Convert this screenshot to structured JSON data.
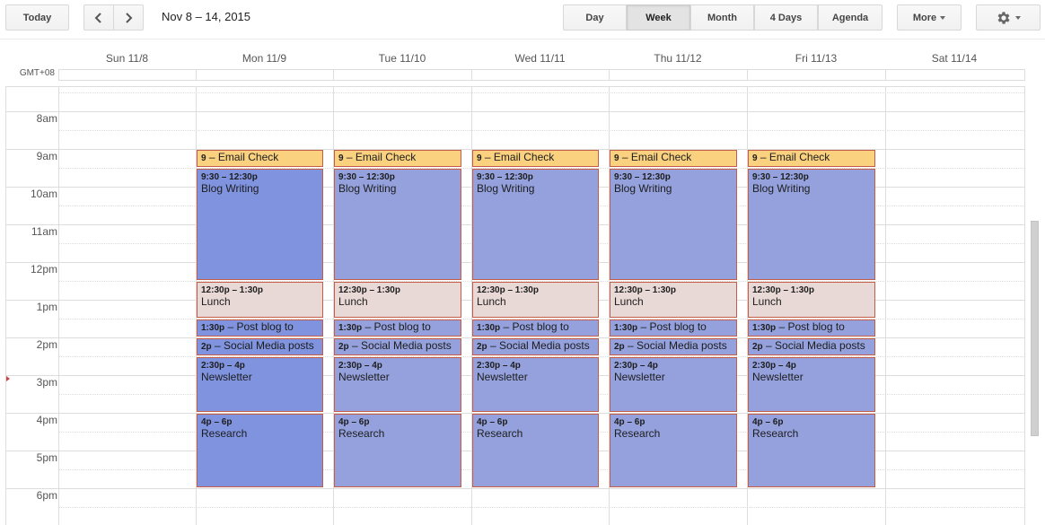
{
  "toolbar": {
    "today_label": "Today",
    "prev_icon": "chevron-left-icon",
    "next_icon": "chevron-right-icon",
    "date_range": "Nov 8 – 14, 2015",
    "views": [
      {
        "label": "Day",
        "active": false
      },
      {
        "label": "Week",
        "active": true
      },
      {
        "label": "Month",
        "active": false
      },
      {
        "label": "4 Days",
        "active": false
      },
      {
        "label": "Agenda",
        "active": false
      }
    ],
    "more_label": "More",
    "settings_icon": "gear-icon"
  },
  "timezone": "GMT+08",
  "days": [
    "Sun 11/8",
    "Mon 11/9",
    "Tue 11/10",
    "Wed 11/11",
    "Thu 11/12",
    "Fri 11/13",
    "Sat 11/14"
  ],
  "hours": [
    "8am",
    "9am",
    "10am",
    "11am",
    "12pm",
    "1pm",
    "2pm",
    "3pm",
    "4pm",
    "5pm",
    "6pm"
  ],
  "colors": {
    "email": "#f9d17f",
    "blue_selected": "#7f93df",
    "blue": "#94a1dd",
    "lunch": "#e9d9d6",
    "border": "#c45c48"
  },
  "events_per_day": [
    {
      "time": "9",
      "title": "Email Check",
      "start": 9.0,
      "end": 9.5,
      "kind": "email",
      "one_line": true
    },
    {
      "time": "9:30 – 12:30p",
      "title": "Blog Writing",
      "start": 9.5,
      "end": 12.5,
      "kind": "blue",
      "one_line": false
    },
    {
      "time": "12:30p – 1:30p",
      "title": "Lunch",
      "start": 12.5,
      "end": 13.5,
      "kind": "lunch",
      "one_line": false
    },
    {
      "time": "1:30p",
      "title": "Post blog to Word",
      "start": 13.5,
      "end": 14.0,
      "kind": "blue",
      "one_line": true
    },
    {
      "time": "2p",
      "title": "Social Media posts",
      "start": 14.0,
      "end": 14.5,
      "kind": "blue",
      "one_line": true
    },
    {
      "time": "2:30p – 4p",
      "title": "Newsletter",
      "start": 14.5,
      "end": 16.0,
      "kind": "blue",
      "one_line": false
    },
    {
      "time": "4p – 6p",
      "title": "Research",
      "start": 16.0,
      "end": 18.0,
      "kind": "blue",
      "one_line": false
    }
  ],
  "event_days": [
    1,
    2,
    3,
    4,
    5
  ],
  "highlighted_day": 1
}
